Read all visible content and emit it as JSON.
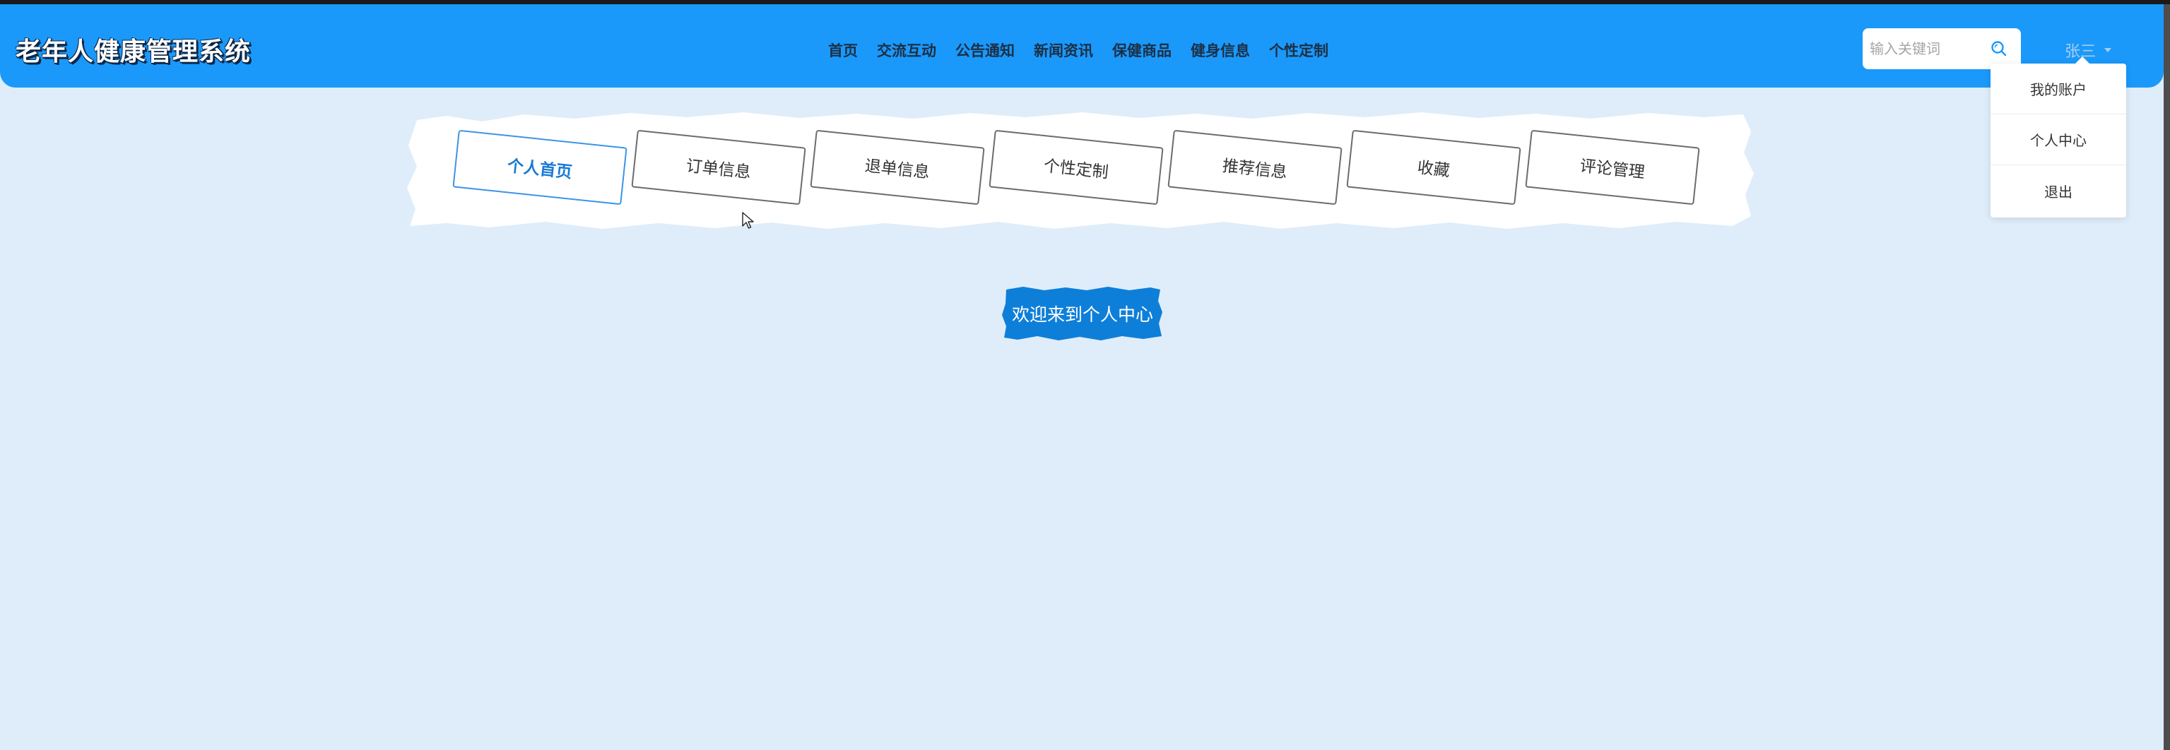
{
  "app": {
    "title": "老年人健康管理系统"
  },
  "nav": {
    "items": [
      "首页",
      "交流互动",
      "公告通知",
      "新闻资讯",
      "保健商品",
      "健身信息",
      "个性定制"
    ]
  },
  "search": {
    "placeholder": "输入关键词",
    "icon": "search-icon"
  },
  "user": {
    "name": "张三",
    "menu": [
      "我的账户",
      "个人中心",
      "退出"
    ]
  },
  "tabs": {
    "active_index": 0,
    "items": [
      "个人首页",
      "订单信息",
      "退单信息",
      "个性定制",
      "推荐信息",
      "收藏",
      "评论管理"
    ]
  },
  "main": {
    "welcome": "欢迎来到个人中心"
  },
  "colors": {
    "header_bg": "#1a99fb",
    "page_bg": "#dfedfa",
    "accent": "#1a7ad6",
    "welcome_bg": "#0e7fd9"
  }
}
